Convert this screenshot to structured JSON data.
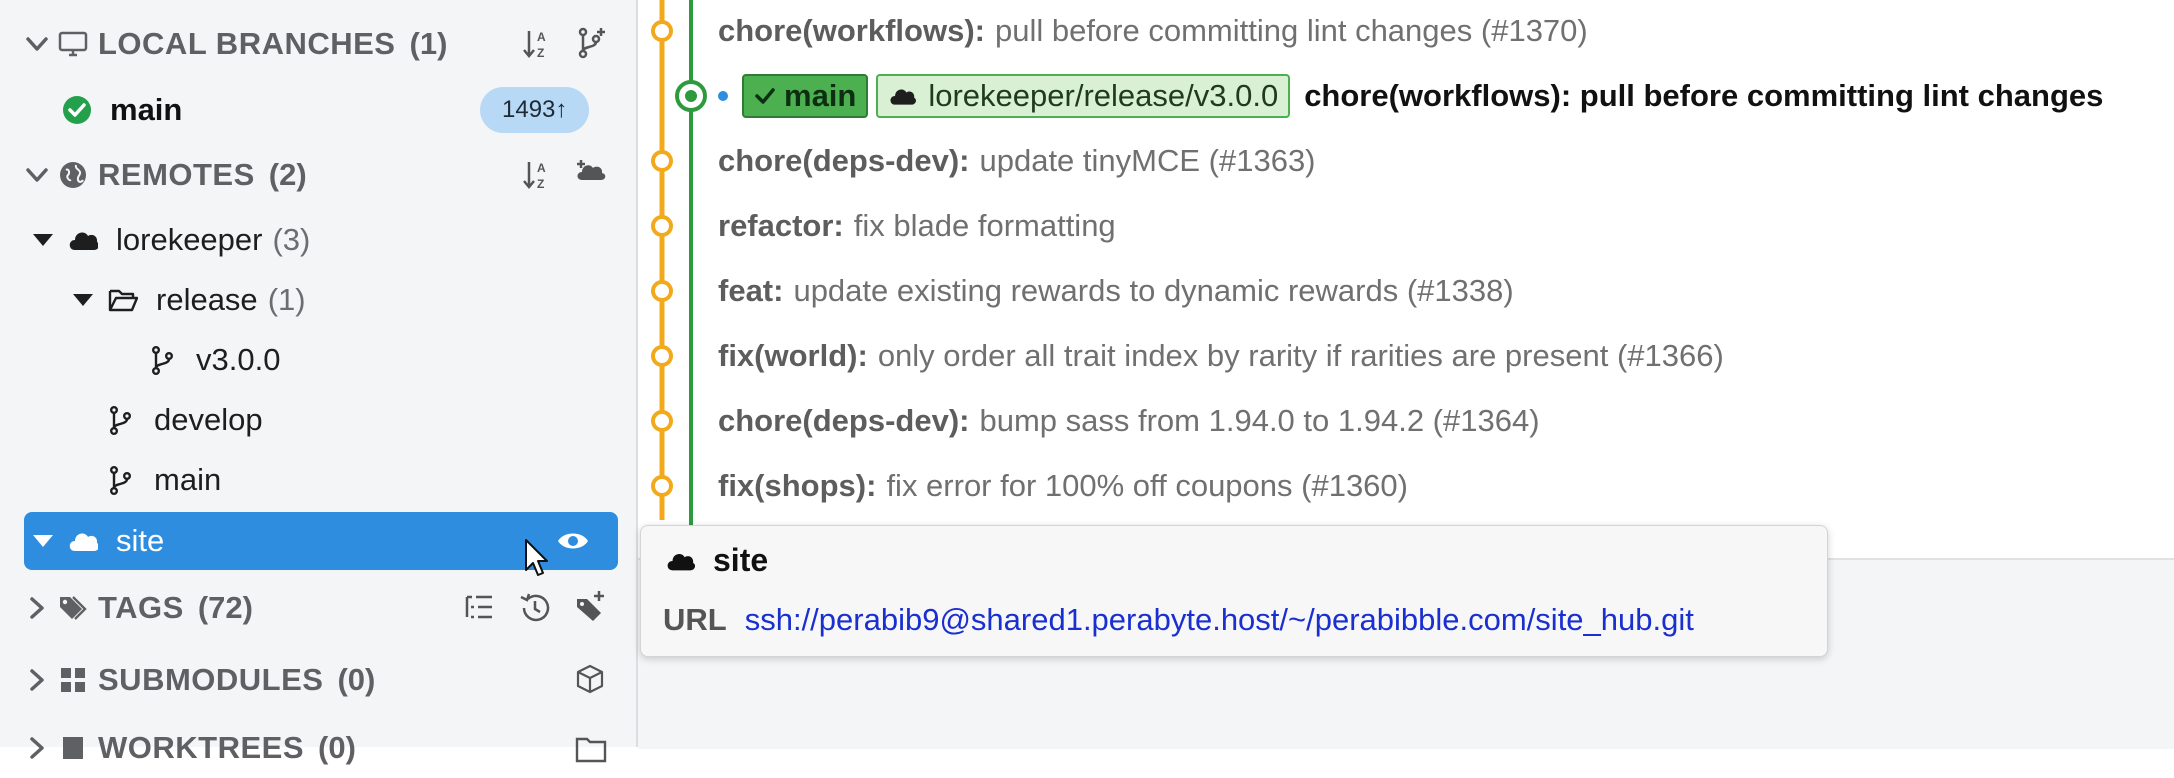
{
  "sidebar": {
    "local_branches": {
      "title": "LOCAL BRANCHES",
      "count": "(1)"
    },
    "local_items": [
      {
        "label": "main",
        "badge": "1493↑",
        "icon": "check-circle-icon"
      }
    ],
    "remotes": {
      "title": "REMOTES",
      "count": "(2)"
    },
    "remote_tree": {
      "lorekeeper": {
        "label": "lorekeeper",
        "count": "(3)"
      },
      "release": {
        "label": "release",
        "count": "(1)"
      },
      "v300": {
        "label": "v3.0.0"
      },
      "develop": {
        "label": "develop"
      },
      "main": {
        "label": "main"
      },
      "site": {
        "label": "site"
      }
    },
    "tags": {
      "title": "TAGS",
      "count": "(72)"
    },
    "submodules": {
      "title": "SUBMODULES",
      "count": "(0)"
    },
    "worktrees": {
      "title": "WORKTREES",
      "count": "(0)"
    },
    "colors": {
      "selected": "#2f8de0",
      "badge": "#b8d9f5",
      "success": "#22a04b"
    }
  },
  "graph": {
    "commits": [
      {
        "type": "chore(workflows):",
        "msg": "pull before committing lint changes (#1370)"
      },
      {
        "type": "chore(deps-dev):",
        "msg": "update tinyMCE (#1363)"
      },
      {
        "type": "refactor:",
        "msg": "fix blade formatting"
      },
      {
        "type": "feat:",
        "msg": "update existing rewards to dynamic rewards (#1338)"
      },
      {
        "type": "fix(world):",
        "msg": "only order all trait index by rarity if rarities are present (#1366)"
      },
      {
        "type": "chore(deps-dev):",
        "msg": "bump sass from 1.94.0 to 1.94.2 (#1364)"
      },
      {
        "type": "fix(shops):",
        "msg": "fix error for 100% off coupons (#1360)"
      }
    ],
    "head": {
      "branch_label": "main",
      "remote_label": "lorekeeper/release/v3.0.0",
      "message": "chore(workflows): pull before committing lint changes"
    },
    "colors": {
      "lane_orange": "#f2a91b",
      "lane_green": "#2e9a3e",
      "branch_tag": "#4caf50"
    }
  },
  "tooltip": {
    "title": "site",
    "url_label": "URL",
    "url": "ssh://perabib9@shared1.perabyte.host/~/perabibble.com/site_hub.git"
  }
}
